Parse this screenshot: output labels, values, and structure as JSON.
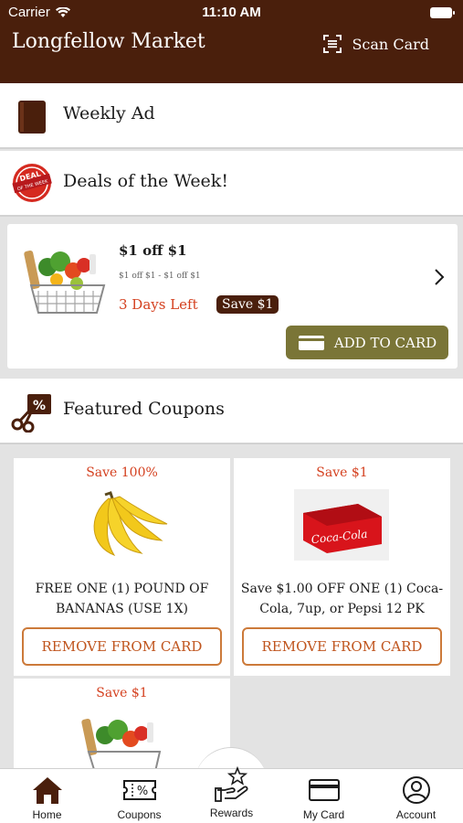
{
  "status_bar": {
    "carrier": "Carrier",
    "time": "11:10 AM"
  },
  "header": {
    "title": "Longfellow Market",
    "scan_label": "Scan Card"
  },
  "sections": {
    "weekly_ad": "Weekly Ad",
    "deals": "Deals of the Week!",
    "featured": "Featured Coupons"
  },
  "deal": {
    "title": "$1 off $1",
    "subtitle": "$1 off $1 - $1 off $1",
    "days_left": "3 Days Left",
    "save": "Save $1",
    "add_button": "ADD TO CARD"
  },
  "coupons": [
    {
      "save": "Save 100%",
      "description": "FREE ONE (1) POUND OF BANANAS (USE 1X)",
      "button": "REMOVE FROM CARD"
    },
    {
      "save": "Save $1",
      "description": "Save $1.00 OFF ONE (1) Coca-Cola, 7up, or Pepsi 12 PK",
      "button": "REMOVE FROM CARD"
    },
    {
      "save": "Save $1"
    }
  ],
  "tabs": [
    {
      "label": "Home",
      "active": true
    },
    {
      "label": "Coupons"
    },
    {
      "label": "Rewards"
    },
    {
      "label": "My Card"
    },
    {
      "label": "Account"
    }
  ],
  "colors": {
    "brand": "#4a1f0c",
    "accent_red": "#d4401f",
    "add_button": "#7a7537",
    "remove_border": "#cc7a3a"
  },
  "icons": [
    "wifi-icon",
    "battery-icon",
    "scan-icon",
    "book-icon",
    "deal-seal-icon",
    "chevron-right-icon",
    "card-icon",
    "coupon-scissors-icon",
    "home-icon",
    "coupon-icon",
    "rewards-icon",
    "my-card-icon",
    "account-icon"
  ]
}
